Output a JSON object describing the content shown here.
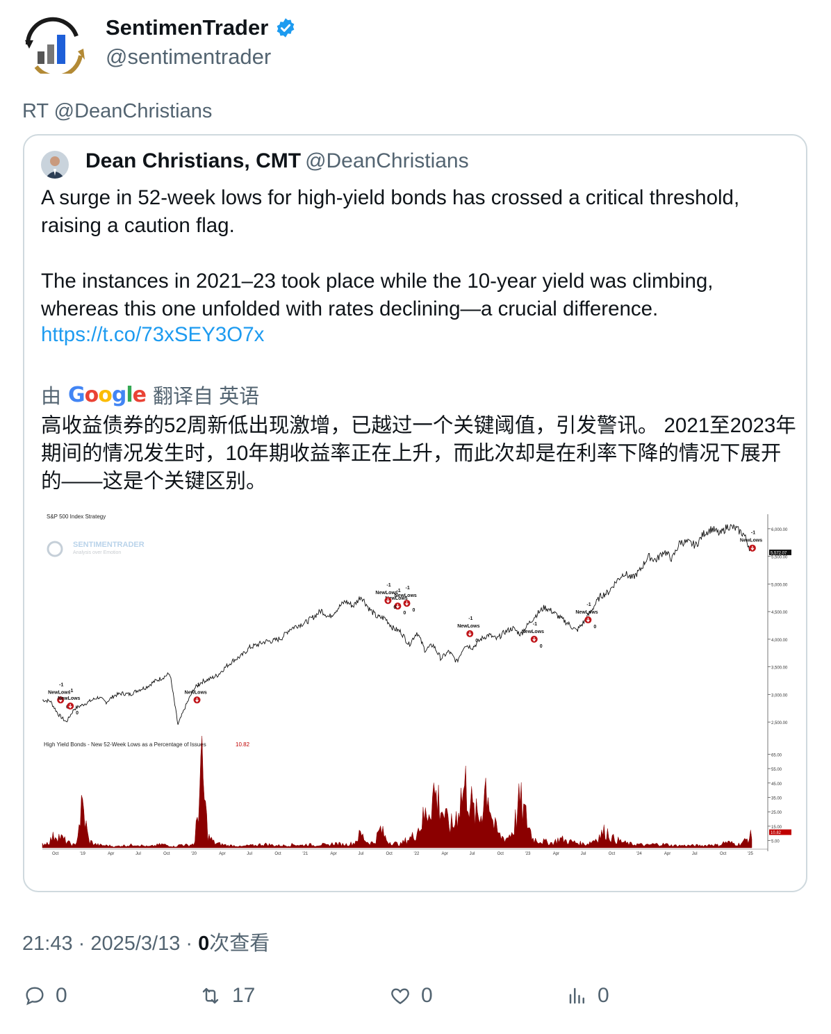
{
  "author": {
    "name": "SentimenTrader",
    "handle": "@sentimentrader",
    "verified_icon": "verified-badge-icon",
    "badge_color": "#1d9bf0"
  },
  "retweet_line": "RT @DeanChristians",
  "quoted": {
    "name": "Dean Christians, CMT",
    "handle": "@DeanChristians",
    "text": "A surge in 52-week lows for high-yield bonds has crossed a critical threshold, raising a caution flag.\n\nThe instances in 2021–23 took place while the 10-year yield was climbing, whereas this one unfolded with rates declining—a crucial difference.",
    "link": "https://t.co/73xSEY3O7x",
    "translated_by_prefix": "由",
    "translated_by_brand": "Google",
    "translated_by_suffix": "翻译自 英语",
    "translation": "高收益债券的52周新低出现激增，已越过一个关键阈值，引发警讯。 2021至2023年期间的情况发生时，10年期收益率正在上升，而此次却是在利率下降的情况下展开的——这是个关键区别。"
  },
  "meta": {
    "time": "21:43",
    "sep1": " · ",
    "date": "2025/3/13",
    "sep2": " · ",
    "views_count": "0",
    "views_label": "次查看"
  },
  "actions": {
    "reply_count": "0",
    "retweet_count": "17",
    "like_count": "0",
    "views_count": "0"
  },
  "chart_data": [
    {
      "type": "line",
      "title": "S&P 500 Index Strategy",
      "watermark": "SENTIMENTRADER",
      "watermark_sub": "Analysis over Emotion",
      "last_value_label": "5,572.07",
      "y_ticks": [
        "6,000.00",
        "5,500.00",
        "5,000.00",
        "4,500.00",
        "4,000.00",
        "3,500.00",
        "3,000.00",
        "2,500.00"
      ],
      "ylim": [
        2300,
        6200
      ],
      "x_ticks": [
        "Oct",
        "'19",
        "Apr",
        "Jul",
        "Oct",
        "'20",
        "Apr",
        "Jul",
        "Oct",
        "'21",
        "Apr",
        "Jul",
        "Oct",
        "'22",
        "Apr",
        "Jul",
        "Oct",
        "'23",
        "Apr",
        "Jul",
        "Oct",
        "'24",
        "Apr",
        "Jul",
        "Oct",
        "'25"
      ],
      "series": [
        {
          "values": [
            2900,
            2880,
            2640,
            2500,
            2740,
            2810,
            2880,
            2950,
            2860,
            2980,
            3020,
            3000,
            3080,
            3130,
            3230,
            3300,
            3380,
            2450,
            2800,
            3100,
            3230,
            3280,
            3350,
            3500,
            3620,
            3700,
            3850,
            3900,
            3960,
            3970,
            4020,
            4180,
            4250,
            4300,
            4400,
            4520,
            4400,
            4550,
            4690,
            4600,
            4780,
            4550,
            4400,
            4380,
            4200,
            4130,
            3900,
            4130,
            3800,
            3900,
            3650,
            3780,
            3590,
            3900,
            3850,
            4000,
            4080,
            4000,
            4130,
            4200,
            4090,
            4280,
            4450,
            4580,
            4500,
            4380,
            4280,
            4150,
            4320,
            4550,
            4780,
            4850,
            5050,
            5200,
            5100,
            5250,
            5500,
            5430,
            5600,
            5450,
            5760,
            5750,
            5700,
            5920,
            6000,
            5900,
            6050,
            6000,
            5900,
            5570
          ]
        }
      ],
      "signals": [
        {
          "label": "NewLows",
          "count": "-1",
          "outcome": "0",
          "x": "Dec 2018",
          "value": 2900
        },
        {
          "label": "NewLows",
          "count": "-1",
          "outcome": "0",
          "x": "Dec 2018",
          "value": 2790
        },
        {
          "label": "NewLows",
          "count": "-1",
          "outcome": "",
          "x": "Mar 2020",
          "value": 2900
        },
        {
          "label": "NewLows",
          "count": "-1",
          "outcome": "0",
          "x": "Dec 2021",
          "value": 4600
        },
        {
          "label": "NewLows",
          "count": "-1",
          "outcome": "0",
          "x": "Dec 2021",
          "value": 4700
        },
        {
          "label": "NewLows",
          "count": "-1",
          "outcome": "0",
          "x": "Jan 2022",
          "value": 4650
        },
        {
          "label": "NewLows",
          "count": "-1",
          "outcome": "0",
          "x": "Sep 2022",
          "value": 4100
        },
        {
          "label": "NewLows",
          "count": "-1",
          "outcome": "0",
          "x": "Mar 2023",
          "value": 4000
        },
        {
          "label": "NewLows",
          "count": "-1",
          "outcome": "0",
          "x": "Oct 2023",
          "value": 4350
        },
        {
          "label": "NewLows",
          "count": "-1",
          "outcome": "",
          "x": "Mar 2025",
          "value": 5650
        }
      ]
    },
    {
      "type": "area",
      "title": "High Yield Bonds - New 52-Week Lows as a Percentage of Issues",
      "last_value_label": "10.82",
      "title_value": "10.82",
      "y_ticks": [
        "65.00",
        "55.00",
        "45.00",
        "35.00",
        "25.00",
        "15.00",
        "5.00"
      ],
      "ylim": [
        0,
        70
      ],
      "series": [
        {
          "values": [
            3,
            5,
            12,
            8,
            4,
            2,
            36,
            6,
            3,
            2,
            2,
            1,
            2,
            2,
            3,
            2,
            1,
            2,
            3,
            2,
            1,
            3,
            2,
            4,
            68,
            10,
            4,
            3,
            2,
            2,
            1,
            2,
            2,
            3,
            3,
            2,
            2,
            2,
            3,
            2,
            3,
            2,
            3,
            2,
            4,
            3,
            3,
            4,
            12,
            5,
            4,
            16,
            6,
            4,
            3,
            7,
            10,
            20,
            30,
            48,
            38,
            22,
            18,
            42,
            55,
            30,
            25,
            60,
            20,
            10,
            8,
            15,
            40,
            25,
            8,
            6,
            5,
            4,
            8,
            6,
            5,
            4,
            3,
            6,
            10,
            15,
            8,
            6,
            4,
            3,
            3,
            2,
            3,
            3,
            3,
            2,
            2,
            2,
            2,
            2,
            2,
            3,
            2,
            5,
            4,
            3,
            6,
            10.8
          ]
        }
      ]
    }
  ]
}
